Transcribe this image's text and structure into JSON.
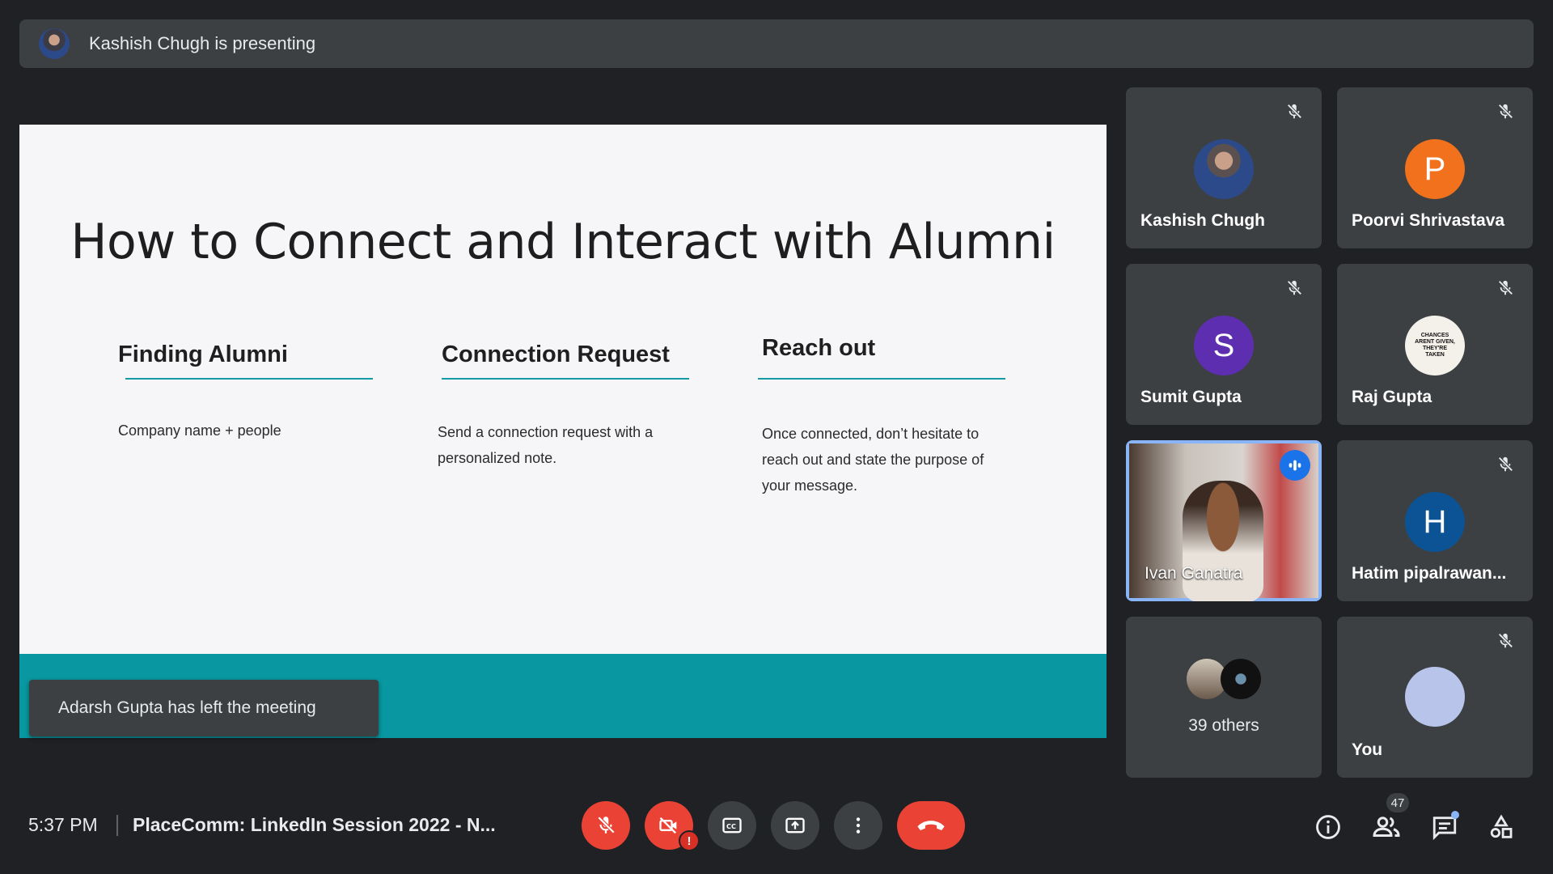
{
  "banner": {
    "text": "Kashish Chugh is presenting"
  },
  "slide": {
    "title": "How to Connect and Interact with Alumni",
    "columns": [
      {
        "heading": "Finding Alumni",
        "body": "Company name + people"
      },
      {
        "heading": "Connection Request",
        "body": "Send a connection request with a personalized note."
      },
      {
        "heading": "Reach out",
        "body": "Once connected, don’t hesitate to reach out and state the purpose of your message."
      }
    ]
  },
  "toast": {
    "text": "Adarsh Gupta has left the meeting"
  },
  "tiles": [
    {
      "name": "Kashish Chugh",
      "avatar": "photo",
      "muted": true
    },
    {
      "name": "Poorvi Shrivastava",
      "initial": "P",
      "color": "#f2711c",
      "muted": true
    },
    {
      "name": "Sumit Gupta",
      "initial": "S",
      "color": "#5d2fb0",
      "muted": true
    },
    {
      "name": "Raj Gupta",
      "avatar": "photo",
      "avatar_text": "CHANCES ARENT GIVEN, THEY'RE TAKEN",
      "muted": true
    },
    {
      "name": "Ivan Ganatra",
      "video": true,
      "speaking": true
    },
    {
      "name": "Hatim pipalrawan...",
      "initial": "H",
      "color": "#0b5394",
      "muted": true
    },
    {
      "label": "39 others"
    },
    {
      "name": "You",
      "avatar": "photo",
      "muted": true
    }
  ],
  "bottom": {
    "time": "5:37 PM",
    "meeting_name": "PlaceComm: LinkedIn Session 2022 - N...",
    "participants_count": "47"
  },
  "colors": {
    "accent": "#139aa2",
    "end_call": "#ea4335",
    "speaking": "#8ab4f8"
  }
}
